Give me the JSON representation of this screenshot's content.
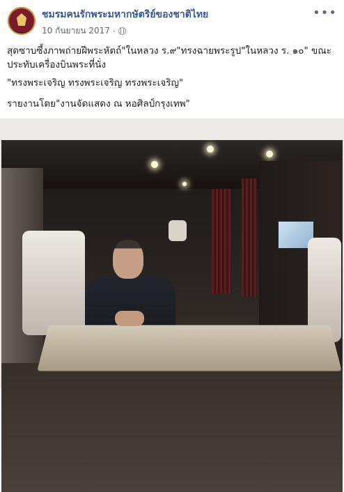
{
  "post": {
    "page_name": "ชมรมคนรักพระมหากษัตริย์ของชาติไทย",
    "timestamp": "10 กันยายน 2017",
    "separator": "·",
    "more": "•••",
    "text_line1": "สุดซาบซึ้งภาพถ่ายฝีพระหัตถ์\"ในหลวง ร.๙\"ทรงฉายพระรูป\"ในหลวง ร. ๑๐\" ขณะประทับเครื่องบินพระที่นั่ง",
    "text_line2": "\"ทรงพระเจริญ ทรงพระเจริญ ทรงพระเจริญ\"",
    "text_line3": "รายงานโดย\"งานจัดแสดง ณ หอศิลป์กรุงเทพ\""
  },
  "icons": {
    "avatar": "page-crest-avatar",
    "privacy": "globe-icon",
    "menu": "more-options-icon"
  },
  "colors": {
    "link": "#385898",
    "meta": "#616770",
    "text": "#1c1e21",
    "frame": "#ece9e6"
  }
}
